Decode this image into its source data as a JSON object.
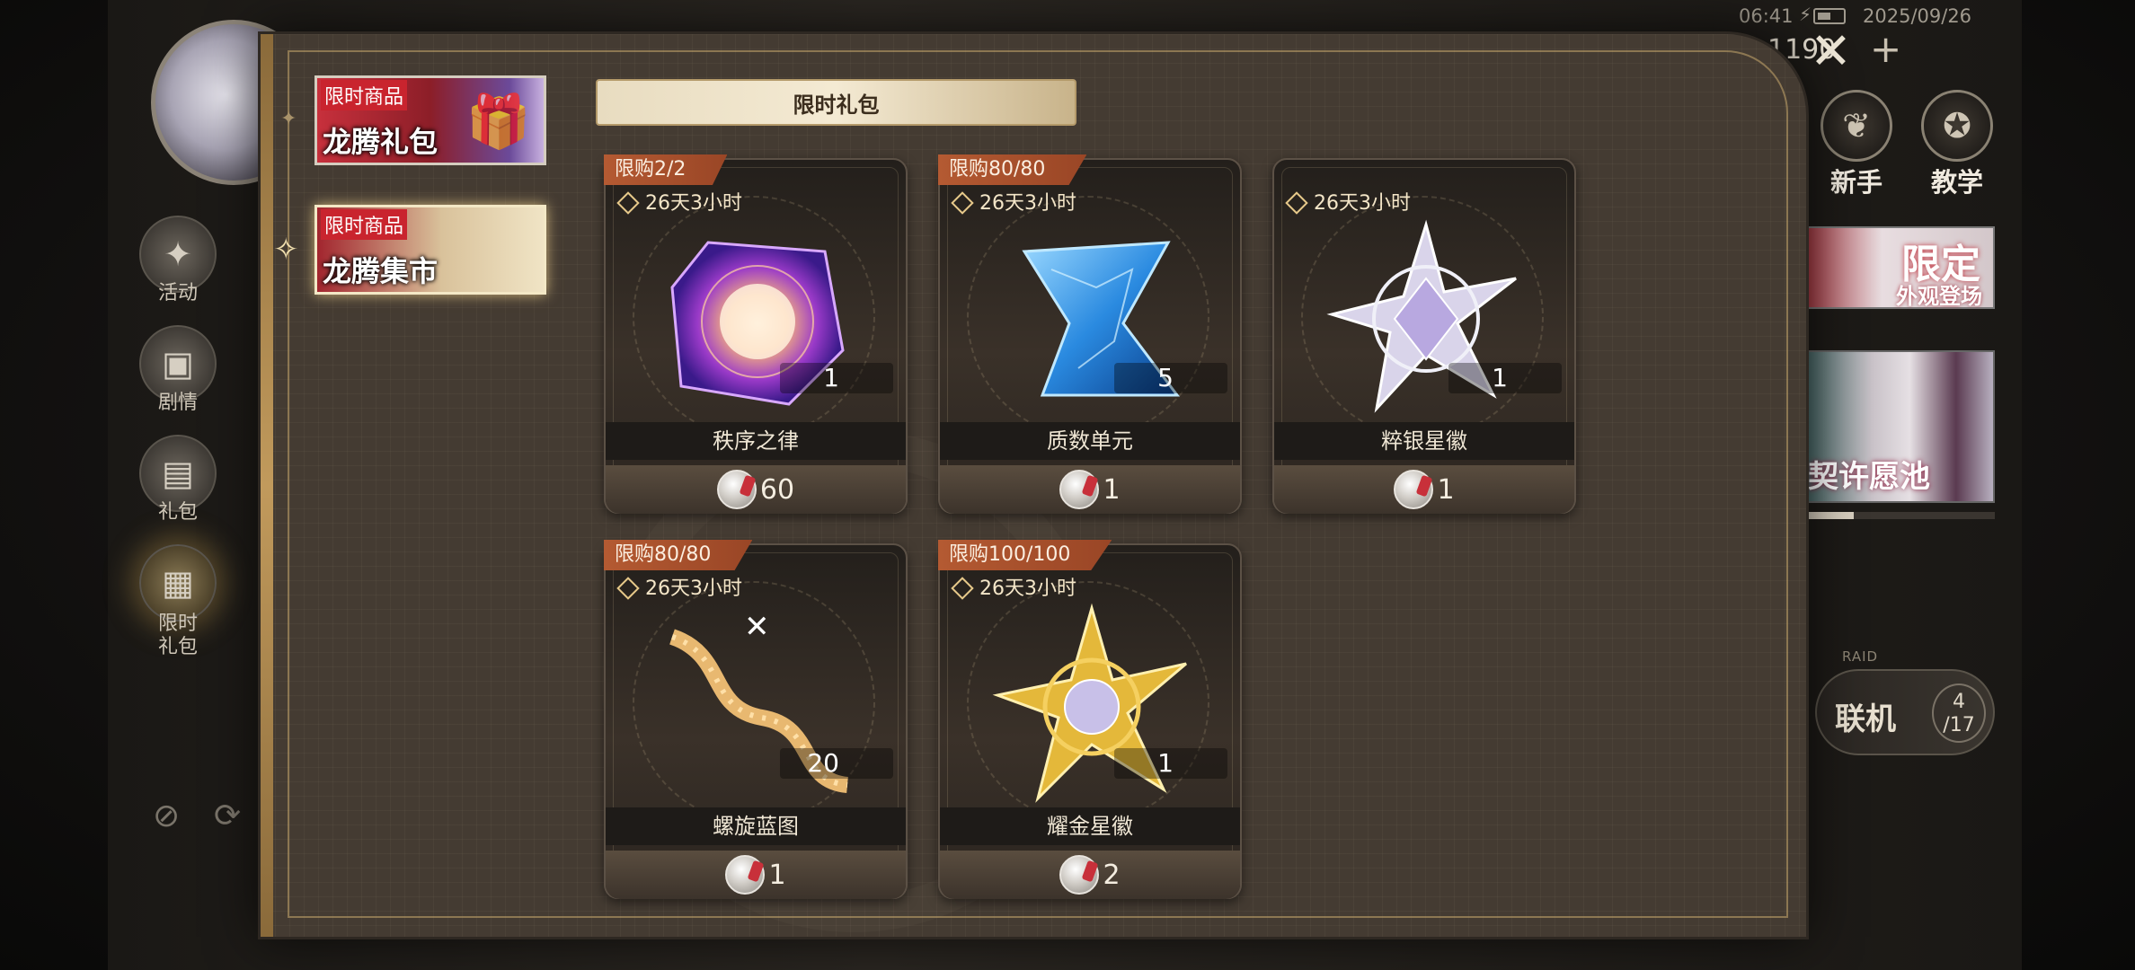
{
  "status_bar": {
    "time": "06:41",
    "date": "2025/09/26"
  },
  "currency": {
    "amount": "1190"
  },
  "left_nav": [
    {
      "label": "活动",
      "icon": "party-popper-icon"
    },
    {
      "label": "剧情",
      "icon": "clapperboard-icon"
    },
    {
      "label": "礼包",
      "icon": "gift-box-icon"
    },
    {
      "label": "限时\n礼包",
      "icon": "limited-gift-icon"
    }
  ],
  "right_tools": [
    {
      "label": "新手",
      "icon": "sprout-icon"
    },
    {
      "label": "教学",
      "icon": "star-gear-icon"
    }
  ],
  "banners": {
    "limited_skin": "限定",
    "limited_skin_sub": "外观登场",
    "wish_pool": "契许愿池",
    "wish_pool_progress": 0.25
  },
  "coop": {
    "label": "联机",
    "count_top": "4",
    "count_bottom": "/17",
    "tag": "RAID"
  },
  "categories": [
    {
      "badge": "限时商品",
      "title": "龙腾礼包",
      "selected": false
    },
    {
      "badge": "限时商品",
      "title": "龙腾集市",
      "selected": true
    }
  ],
  "section_title": "限时礼包",
  "products": [
    {
      "limit": "限购2/2",
      "timer": "26天3小时",
      "qty": "1",
      "name": "秩序之律",
      "price": "60",
      "art": "purple-cube-icon"
    },
    {
      "limit": "限购80/80",
      "timer": "26天3小时",
      "qty": "5",
      "name": "质数单元",
      "price": "1",
      "art": "blue-crystal-icon"
    },
    {
      "limit": "",
      "timer": "26天3小时",
      "qty": "1",
      "name": "粹银星徽",
      "price": "1",
      "art": "silver-star-badge-icon"
    },
    {
      "limit": "限购80/80",
      "timer": "26天3小时",
      "qty": "20",
      "name": "螺旋蓝图",
      "price": "1",
      "art": "gold-helix-icon"
    },
    {
      "limit": "限购100/100",
      "timer": "26天3小时",
      "qty": "1",
      "name": "耀金星徽",
      "price": "2",
      "art": "gold-star-badge-icon"
    }
  ],
  "colors": {
    "panel": "#443b32",
    "limit_tag": "#b45a32",
    "accent_gold": "#c19a5c"
  }
}
